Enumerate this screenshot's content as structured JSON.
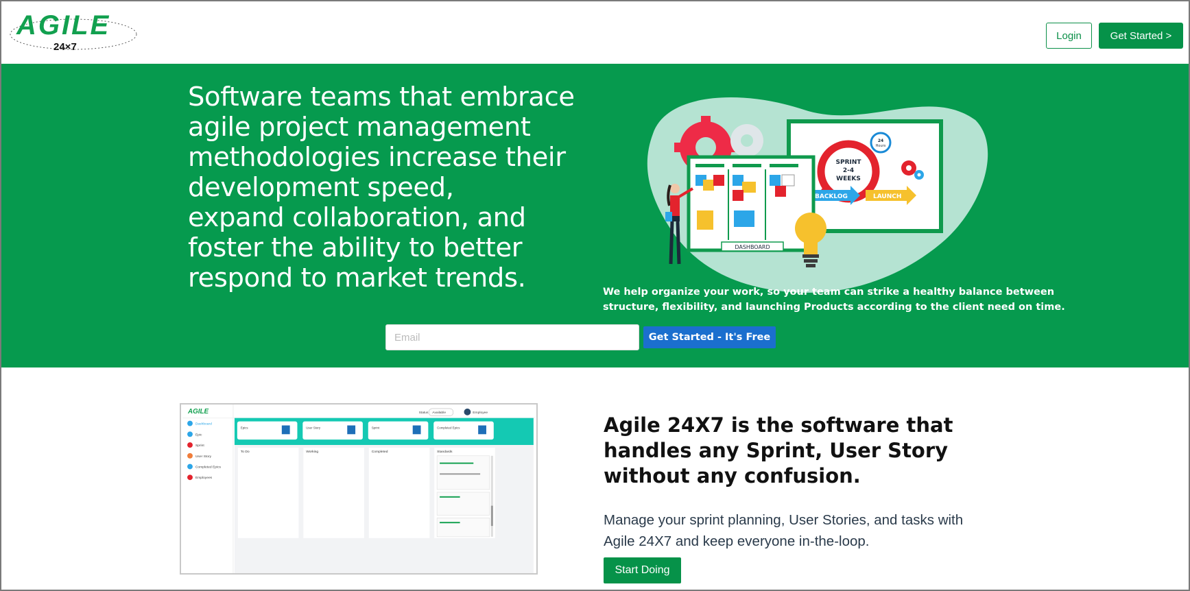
{
  "header": {
    "logo_text": "AGILE",
    "logo_sub": "24×7",
    "login_label": "Login",
    "get_started_label": "Get Started >"
  },
  "hero": {
    "title_lines": [
      "Software teams that embrace",
      "agile project management",
      "methodologies increase their",
      "development speed,",
      "expand collaboration, and",
      "foster the ability to better",
      "respond to market trends."
    ],
    "illustration": {
      "sprint_label": [
        "SPRINT",
        "2-4",
        "WEEKS"
      ],
      "hours_label": [
        "24",
        "Hours"
      ],
      "backlog_label": "BACKLOG",
      "launch_label": "LAUNCH",
      "dashboard_label": "DASHBOARD"
    },
    "subtitle_lines": [
      "We help organize your work, so your team can strike a healthy balance between",
      "structure, flexibility, and launching Products according to the client need on time."
    ],
    "email_placeholder": "Email",
    "cta_label": "Get Started - It's Free"
  },
  "screenshot": {
    "logo_text": "AGILE",
    "status_label": "Status",
    "status_value": "Available",
    "user_label": "Employee",
    "sidebar": [
      "Dashboard",
      "Epic",
      "Sprint",
      "User Story",
      "Completed Epics",
      "Employees"
    ],
    "cards": [
      "Epics",
      "User Story",
      "Sprint",
      "Completed Epics"
    ],
    "columns": [
      "To Do",
      "Working",
      "Completed",
      "Standards"
    ]
  },
  "feature": {
    "title_lines": [
      "Agile 24X7 is the software that",
      "handles any Sprint, User Story",
      "without any confusion."
    ],
    "desc_lines": [
      "Manage your sprint planning, User Stories, and tasks with",
      "Agile 24X7 and keep everyone in-the-loop."
    ],
    "cta_label": "Start Doing"
  },
  "colors": {
    "brand_green": "#069a4e",
    "button_green": "#069249",
    "cta_blue": "#1b6fce"
  }
}
